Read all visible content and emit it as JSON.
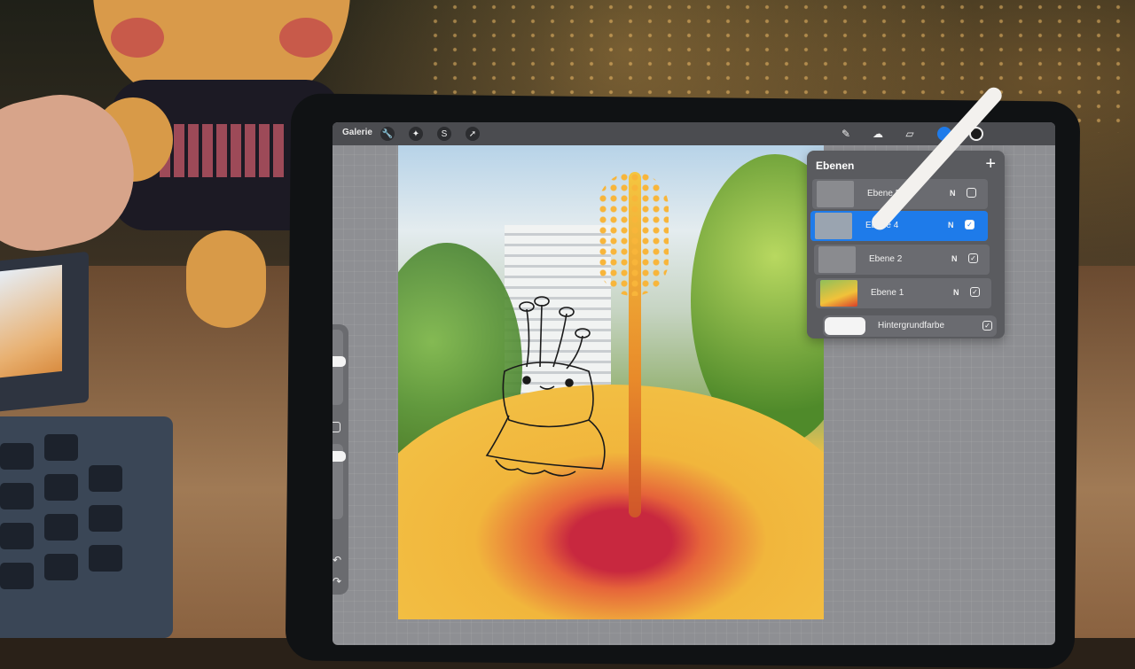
{
  "topbar": {
    "gallery_label": "Galerie",
    "left_tools": [
      {
        "icon": "wrench-icon",
        "glyph": "🔧"
      },
      {
        "icon": "magic-wand-icon",
        "glyph": "✦"
      },
      {
        "icon": "selection-s-icon",
        "glyph": "S"
      },
      {
        "icon": "transform-arrow-icon",
        "glyph": "➚"
      }
    ],
    "right_tools": [
      {
        "icon": "brush-icon",
        "glyph": "✎"
      },
      {
        "icon": "smudge-icon",
        "glyph": "☁"
      },
      {
        "icon": "eraser-icon",
        "glyph": "▱"
      },
      {
        "icon": "layers-icon",
        "glyph": "❐"
      }
    ],
    "color_active": "#1e7bea",
    "color_current": "#1c1c1c"
  },
  "layers_panel": {
    "title": "Ebenen",
    "add_label": "+",
    "layers": [
      {
        "name": "Ebene 5",
        "mode": "N",
        "visible": false,
        "active": false
      },
      {
        "name": "Ebene 4",
        "mode": "N",
        "visible": true,
        "active": true
      },
      {
        "name": "Ebene 2",
        "mode": "N",
        "visible": true,
        "active": false
      },
      {
        "name": "Ebene 1",
        "mode": "N",
        "visible": true,
        "active": false
      }
    ],
    "background": {
      "name": "Hintergrundfarbe",
      "visible": true,
      "color": "#f4f4f4"
    }
  },
  "sidebar": {
    "undo_icon": "↶",
    "redo_icon": "↷"
  },
  "accent_color": "#1e7bea"
}
